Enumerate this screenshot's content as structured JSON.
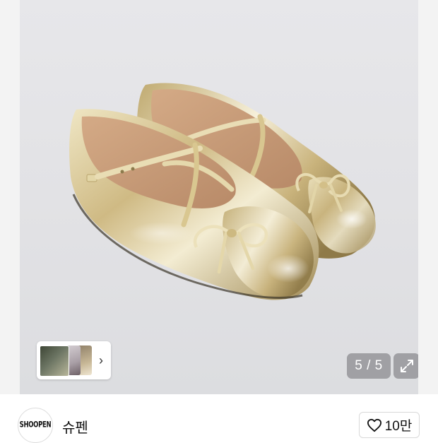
{
  "gallery": {
    "product_image_alt": "gold metallic ballet flats with cross straps and bows",
    "current_page": 5,
    "total_pages": 5,
    "counter_text": "5 / 5",
    "thumb_chevron": "›",
    "expand_icon": "expand-icon"
  },
  "seller": {
    "logo_text": "SHOOPEN",
    "name": "슈펜"
  },
  "like": {
    "icon": "heart-outline-icon",
    "count": "10만"
  },
  "colors": {
    "background": "#e3e3e6",
    "gold": "#d9c48f"
  }
}
